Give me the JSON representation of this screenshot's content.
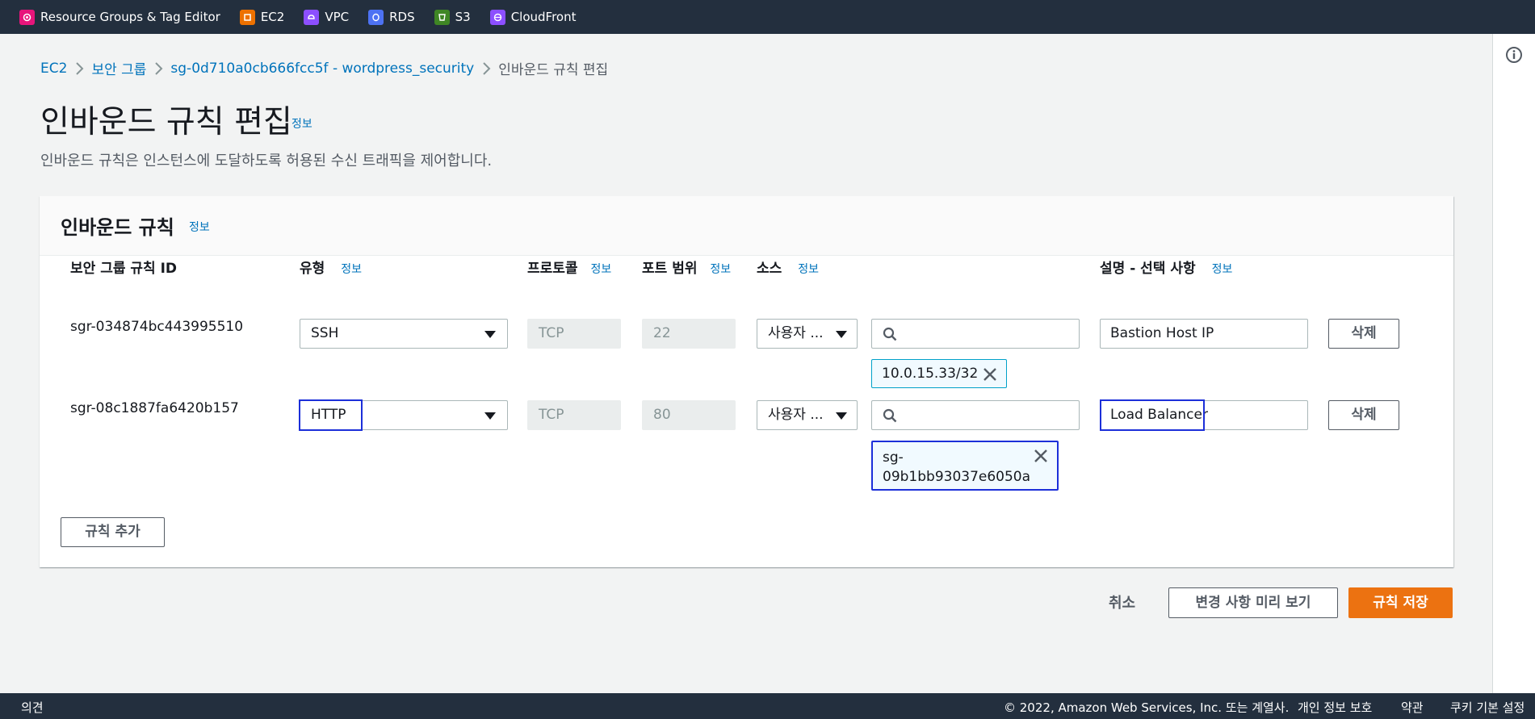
{
  "topnav": {
    "items": [
      {
        "label": "Resource Groups & Tag Editor",
        "icon": "resource-groups-icon",
        "color": "#e7157b"
      },
      {
        "label": "EC2",
        "icon": "ec2-icon",
        "color": "#ed7100"
      },
      {
        "label": "VPC",
        "icon": "vpc-icon",
        "color": "#8c4fff"
      },
      {
        "label": "RDS",
        "icon": "rds-icon",
        "color": "#4d72f3"
      },
      {
        "label": "S3",
        "icon": "s3-icon",
        "color": "#3f8624"
      },
      {
        "label": "CloudFront",
        "icon": "cloudfront-icon",
        "color": "#8c4fff"
      }
    ]
  },
  "breadcrumb": {
    "items": [
      "EC2",
      "보안 그룹",
      "sg-0d710a0cb666fcc5f - wordpress_security"
    ],
    "current": "인바운드 규칙 편집"
  },
  "page": {
    "title": "인바운드 규칙 편집",
    "info": "정보",
    "description": "인바운드 규칙은 인스턴스에 도달하도록 허용된 수신 트래픽을 제어합니다."
  },
  "panel": {
    "title": "인바운드 규칙",
    "info": "정보",
    "columns": {
      "rule_id": "보안 그룹 규칙 ID",
      "type": "유형",
      "protocol": "프로토콜",
      "port": "포트 범위",
      "source": "소스",
      "description": "설명 - 선택 사항",
      "info": "정보"
    },
    "rules": [
      {
        "id": "sgr-034874bc443995510",
        "type": "SSH",
        "protocol": "TCP",
        "port": "22",
        "source_type": "사용자 ...",
        "source_token": "10.0.15.33/32",
        "description": "Bastion Host IP",
        "delete_label": "삭제"
      },
      {
        "id": "sgr-08c1887fa6420b157",
        "type": "HTTP",
        "protocol": "TCP",
        "port": "80",
        "source_type": "사용자 ...",
        "source_token_line1": "sg-",
        "source_token_line2": "09b1bb93037e6050a",
        "description": "Load Balancer",
        "delete_label": "삭제"
      }
    ],
    "add_rule_label": "규칙 추가"
  },
  "actions": {
    "cancel": "취소",
    "preview": "변경 사항 미리 보기",
    "save": "규칙 저장"
  },
  "footer": {
    "feedback": "의견",
    "copyright": "© 2022, Amazon Web Services, Inc. 또는 계열사.",
    "privacy": "개인 정보 보호",
    "terms": "약관",
    "cookies": "쿠키 기본 설정"
  },
  "colors": {
    "accent": "#ec7211",
    "link": "#0073bb",
    "nav_bg": "#232f3e",
    "focus": "#1c2fd9"
  }
}
